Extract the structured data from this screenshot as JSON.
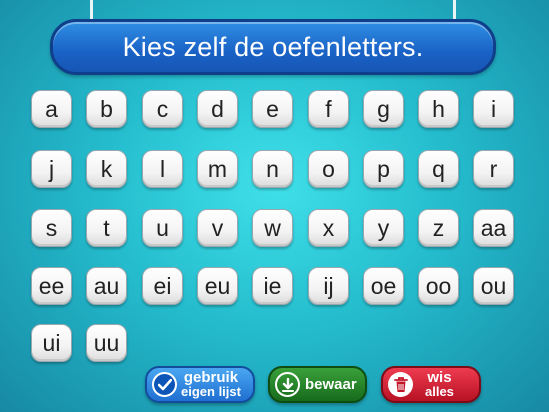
{
  "title": "Kies zelf de oefenletters.",
  "letters": [
    "a",
    "b",
    "c",
    "d",
    "e",
    "f",
    "g",
    "h",
    "i",
    "j",
    "k",
    "l",
    "m",
    "n",
    "o",
    "p",
    "q",
    "r",
    "s",
    "t",
    "u",
    "v",
    "w",
    "x",
    "y",
    "z",
    "aa",
    "ee",
    "au",
    "ei",
    "eu",
    "ie",
    "ij",
    "oe",
    "oo",
    "ou",
    "ui",
    "uu"
  ],
  "buttons": {
    "use_list": {
      "line1": "gebruik",
      "line2": "eigen lijst",
      "icon": "check-icon"
    },
    "save": {
      "label": "bewaar",
      "icon": "download-icon"
    },
    "clear": {
      "line1": "wis",
      "line2": "alles",
      "icon": "trash-icon"
    }
  },
  "colors": {
    "title_banner": "#1a62c6",
    "use_list": "#1f6fd1",
    "save": "#176b1c",
    "clear": "#b81225"
  }
}
